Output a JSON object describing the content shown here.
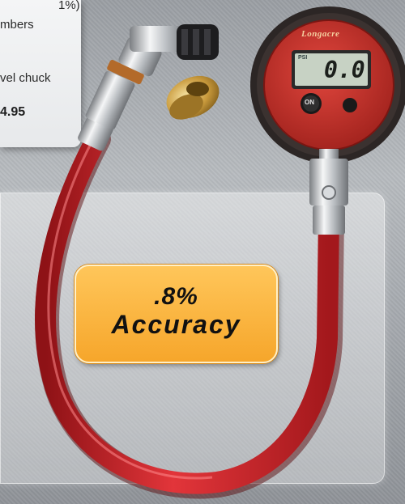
{
  "info_panel": {
    "line1": "1%)",
    "line2": "mbers",
    "line3": "vel chuck",
    "price": "4.95"
  },
  "badge": {
    "accuracy_value": ".8%",
    "accuracy_word": "Accuracy"
  },
  "gauge": {
    "brand": "Longacre",
    "display_value": "0.0",
    "mode_indicator": "PSI",
    "on_label": "ON"
  },
  "colors": {
    "hose_red": "#d8262c",
    "badge_orange": "#f8ac34",
    "gauge_face_red": "#c8312a",
    "lcd_green": "#c7d2c4"
  }
}
